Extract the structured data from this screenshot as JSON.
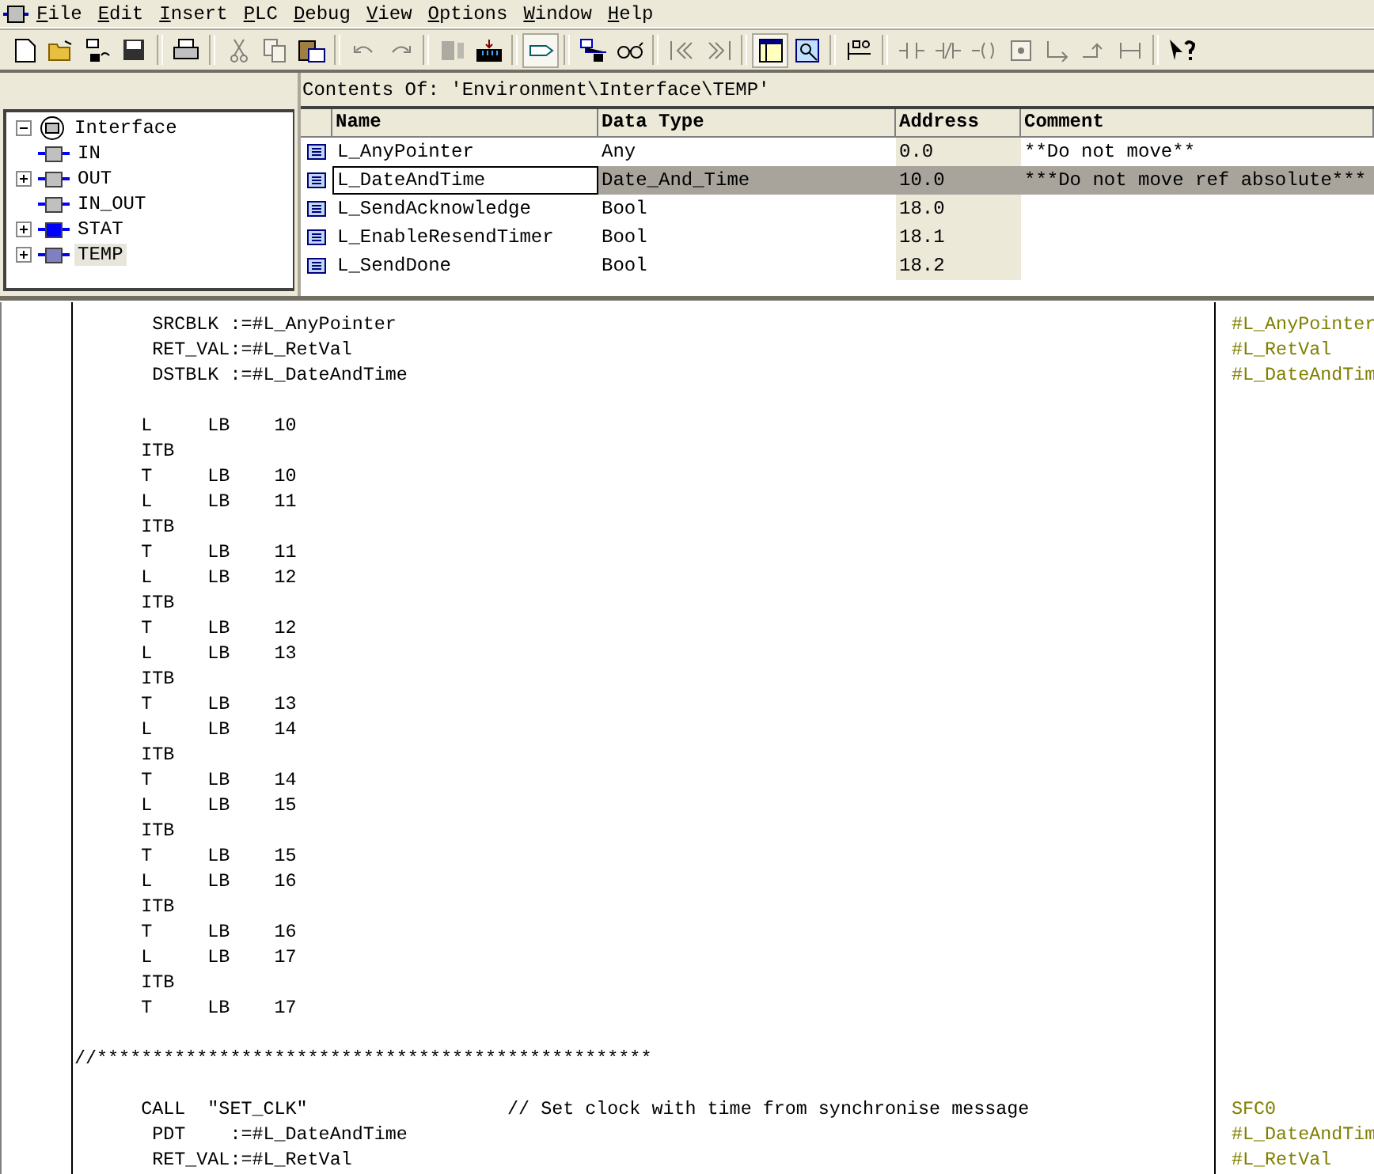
{
  "menu": [
    "File",
    "Edit",
    "Insert",
    "PLC",
    "Debug",
    "View",
    "Options",
    "Window",
    "Help"
  ],
  "toolbar": [
    {
      "kind": "new",
      "disabled": false,
      "pressed": false
    },
    {
      "kind": "open",
      "disabled": false,
      "pressed": false
    },
    {
      "kind": "nodes",
      "disabled": false,
      "pressed": false
    },
    {
      "kind": "save",
      "disabled": false,
      "pressed": false
    },
    {
      "kind": "sep"
    },
    {
      "kind": "print",
      "disabled": false,
      "pressed": false
    },
    {
      "kind": "sep"
    },
    {
      "kind": "cut",
      "disabled": true,
      "pressed": false
    },
    {
      "kind": "copy",
      "disabled": true,
      "pressed": false
    },
    {
      "kind": "paste",
      "disabled": false,
      "pressed": false
    },
    {
      "kind": "sep"
    },
    {
      "kind": "undo",
      "disabled": true,
      "pressed": false
    },
    {
      "kind": "redo",
      "disabled": true,
      "pressed": false
    },
    {
      "kind": "sep"
    },
    {
      "kind": "compile",
      "disabled": true,
      "pressed": false
    },
    {
      "kind": "download",
      "disabled": false,
      "pressed": false
    },
    {
      "kind": "sep"
    },
    {
      "kind": "monitor",
      "disabled": false,
      "pressed": true
    },
    {
      "kind": "sep"
    },
    {
      "kind": "network",
      "disabled": false,
      "pressed": false
    },
    {
      "kind": "glasses",
      "disabled": false,
      "pressed": false
    },
    {
      "kind": "sep"
    },
    {
      "kind": "prev",
      "disabled": true,
      "pressed": false
    },
    {
      "kind": "next",
      "disabled": true,
      "pressed": false
    },
    {
      "kind": "sep"
    },
    {
      "kind": "overview",
      "disabled": false,
      "pressed": true
    },
    {
      "kind": "details",
      "disabled": false,
      "pressed": false
    },
    {
      "kind": "sep"
    },
    {
      "kind": "ladder",
      "disabled": false,
      "pressed": false
    },
    {
      "kind": "sep"
    },
    {
      "kind": "contact",
      "disabled": true,
      "pressed": false
    },
    {
      "kind": "ncontact",
      "disabled": true,
      "pressed": false
    },
    {
      "kind": "coil",
      "disabled": true,
      "pressed": false
    },
    {
      "kind": "box",
      "disabled": true,
      "pressed": false
    },
    {
      "kind": "branch",
      "disabled": true,
      "pressed": false
    },
    {
      "kind": "close",
      "disabled": true,
      "pressed": false
    },
    {
      "kind": "connect",
      "disabled": true,
      "pressed": false
    },
    {
      "kind": "sep"
    },
    {
      "kind": "help",
      "disabled": false,
      "pressed": false
    }
  ],
  "tree": {
    "label": "Interface",
    "expanded": true,
    "children": [
      {
        "label": "IN",
        "kind": "leaf",
        "color": "#c0c0c0",
        "selected": false
      },
      {
        "label": "OUT",
        "kind": "node",
        "color": "#c0c0c0",
        "expanded": false,
        "selected": false
      },
      {
        "label": "IN_OUT",
        "kind": "leaf",
        "color": "#c0c0c0",
        "selected": false
      },
      {
        "label": "STAT",
        "kind": "node",
        "color": "#0000ff",
        "expanded": false,
        "selected": false
      },
      {
        "label": "TEMP",
        "kind": "node",
        "color": "#8080c0",
        "expanded": false,
        "selected": true
      }
    ]
  },
  "contents_title": "Contents Of: 'Environment\\Interface\\TEMP'",
  "table": {
    "columns": [
      "Name",
      "Data Type",
      "Address",
      "Comment"
    ],
    "rows": [
      {
        "name": "L_AnyPointer",
        "type": "Any",
        "address": "0.0",
        "comment": "**Do not move**",
        "selected": false
      },
      {
        "name": "L_DateAndTime",
        "type": "Date_And_Time",
        "address": "10.0",
        "comment": "***Do not move ref absolute***",
        "selected": true
      },
      {
        "name": "L_SendAcknowledge",
        "type": "Bool",
        "address": "18.0",
        "selected": false
      },
      {
        "name": "L_EnableResendTimer",
        "type": "Bool",
        "address": "18.1",
        "selected": false
      },
      {
        "name": "L_SendDone",
        "type": "Bool",
        "address": "18.2",
        "selected": false
      }
    ]
  },
  "code": [
    {
      "text": "       SRCBLK :=#L_AnyPointer",
      "symbol": "#L_AnyPointer"
    },
    {
      "text": "       RET_VAL:=#L_RetVal",
      "symbol": "#L_RetVal"
    },
    {
      "text": "       DSTBLK :=#L_DateAndTime",
      "symbol": "#L_DateAndTim"
    },
    {
      "text": "      L     LB    10",
      "gap_before": true
    },
    {
      "text": "      ITB"
    },
    {
      "text": "      T     LB    10"
    },
    {
      "text": "      L     LB    11"
    },
    {
      "text": "      ITB"
    },
    {
      "text": "      T     LB    11"
    },
    {
      "text": "      L     LB    12"
    },
    {
      "text": "      ITB"
    },
    {
      "text": "      T     LB    12"
    },
    {
      "text": "      L     LB    13"
    },
    {
      "text": "      ITB"
    },
    {
      "text": "      T     LB    13"
    },
    {
      "text": "      L     LB    14"
    },
    {
      "text": "      ITB"
    },
    {
      "text": "      T     LB    14"
    },
    {
      "text": "      L     LB    15"
    },
    {
      "text": "      ITB"
    },
    {
      "text": "      T     LB    15"
    },
    {
      "text": "      L     LB    16"
    },
    {
      "text": "      ITB"
    },
    {
      "text": "      T     LB    16"
    },
    {
      "text": "      L     LB    17"
    },
    {
      "text": "      ITB"
    },
    {
      "text": "      T     LB    17"
    },
    {
      "text": "//**************************************************",
      "gap_before": true
    },
    {
      "text": "      CALL  \"SET_CLK\"                  // Set clock with time from synchronise message",
      "symbol": "SFC0",
      "gap_before": true
    },
    {
      "text": "       PDT    :=#L_DateAndTime",
      "symbol": "#L_DateAndTim"
    },
    {
      "text": "       RET_VAL:=#L_RetVal",
      "symbol": "#L_RetVal"
    }
  ]
}
